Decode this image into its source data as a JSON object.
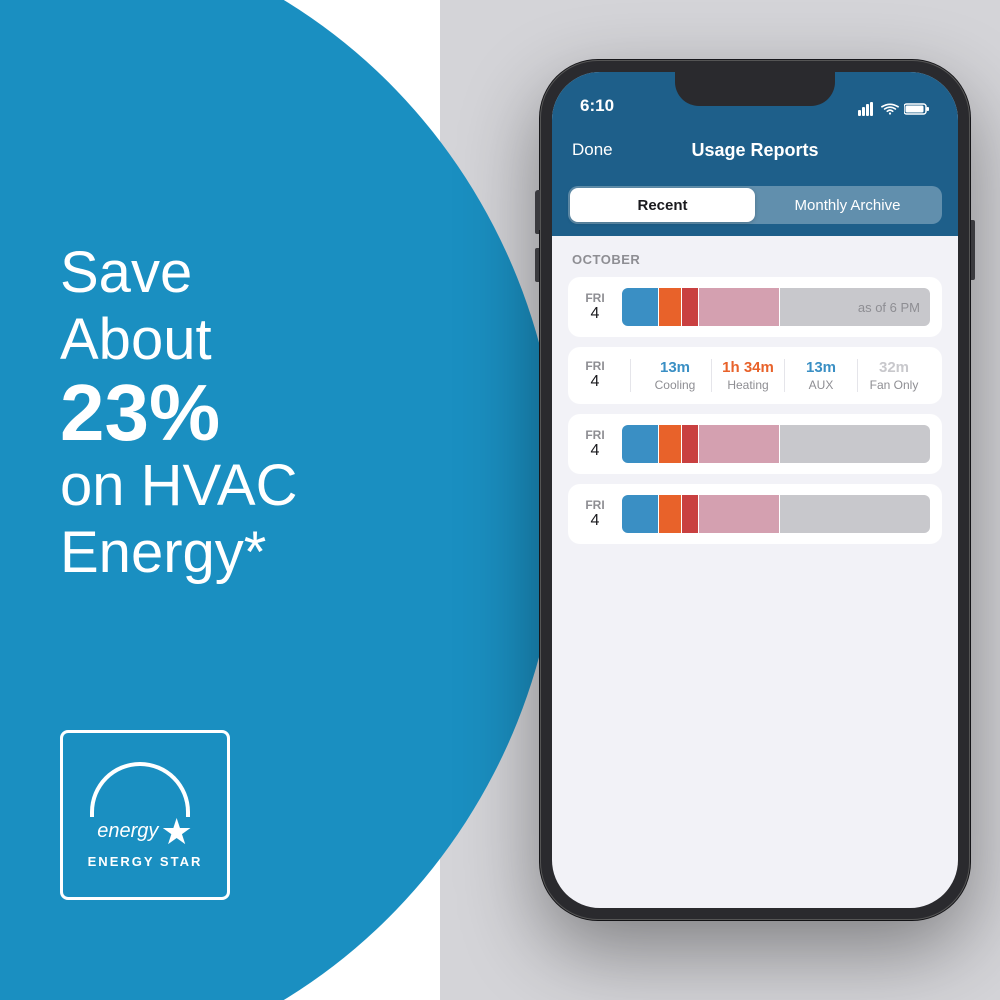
{
  "background": {
    "blue_color": "#1a8fc1",
    "gray_color": "#d4d4d8"
  },
  "left": {
    "line1": "Save",
    "line2": "About",
    "line3": "23%",
    "line4": "on HVAC",
    "line5": "Energy*",
    "energy_star_label": "ENERGY STAR",
    "energy_word": "energy"
  },
  "phone": {
    "status_bar": {
      "time": "6:10",
      "icons": [
        "signal",
        "wifi",
        "battery"
      ]
    },
    "nav": {
      "done_label": "Done",
      "title": "Usage Reports"
    },
    "segments": {
      "recent_label": "Recent",
      "archive_label": "Monthly Archive",
      "active": "recent"
    },
    "section": {
      "month": "OCTOBER"
    },
    "rows": [
      {
        "day_name": "FRI",
        "day_num": "4",
        "type": "bar",
        "as_of": "as of 6 PM"
      },
      {
        "day_name": "FRI",
        "day_num": "4",
        "type": "stats",
        "stats": [
          {
            "value": "13m",
            "label": "Cooling",
            "color": "blue"
          },
          {
            "value": "1h 34m",
            "label": "Heating",
            "color": "orange"
          },
          {
            "value": "13m",
            "label": "AUX",
            "color": "teal"
          },
          {
            "value": "32m",
            "label": "Fan Only",
            "color": "gray"
          }
        ]
      },
      {
        "day_name": "FRI",
        "day_num": "4",
        "type": "bar",
        "as_of": ""
      },
      {
        "day_name": "FRI",
        "day_num": "4",
        "type": "bar",
        "as_of": ""
      }
    ]
  }
}
